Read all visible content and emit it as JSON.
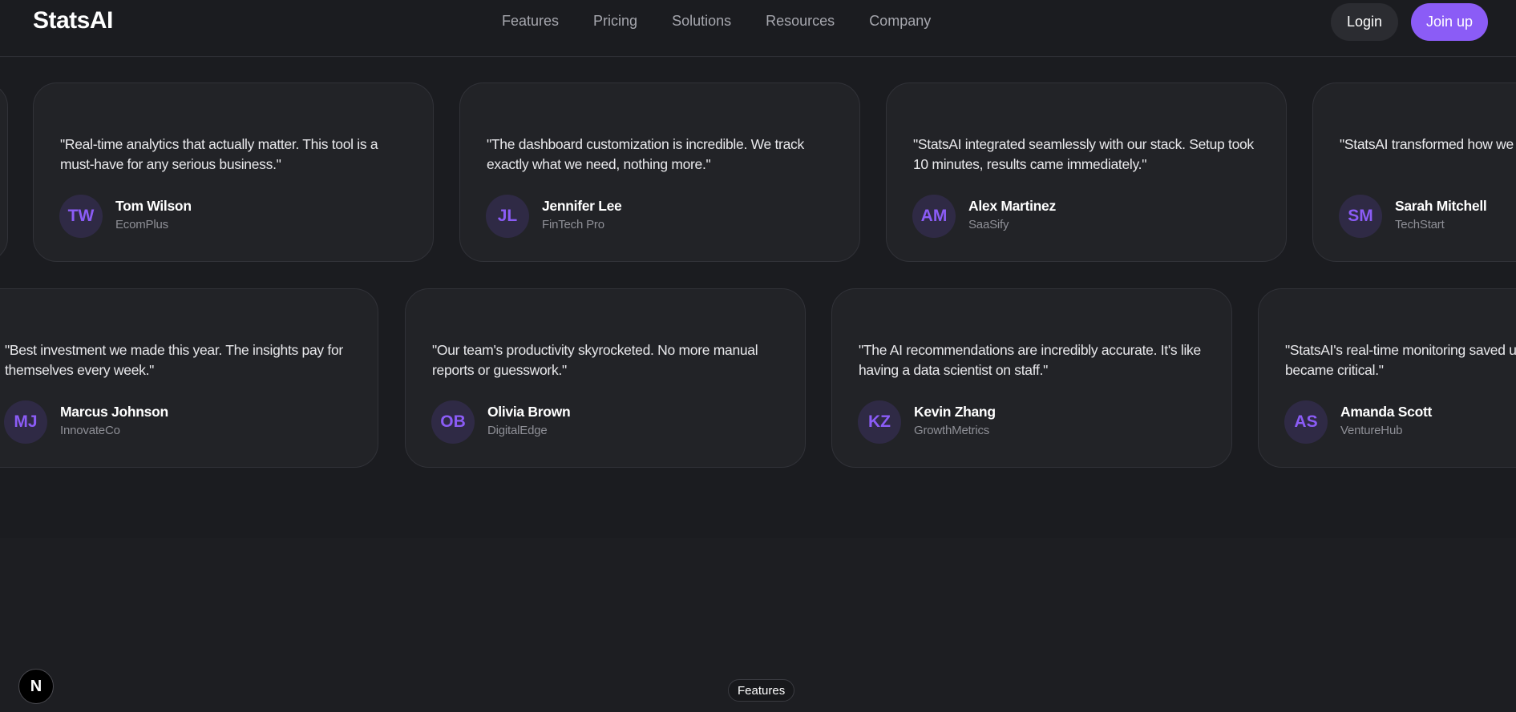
{
  "header": {
    "brand": "StatsAI",
    "nav": [
      "Features",
      "Pricing",
      "Solutions",
      "Resources",
      "Company"
    ],
    "login_label": "Login",
    "join_label": "Join up"
  },
  "testimonials": {
    "row1": [
      {
        "quote": "\"Real-time analytics that actually matter. This tool is a must-have for any serious business.\"",
        "initials": "TW",
        "name": "Tom Wilson",
        "company": "EcomPlus"
      },
      {
        "quote": "\"The dashboard customization is incredible. We track exactly what we need, nothing more.\"",
        "initials": "JL",
        "name": "Jennifer Lee",
        "company": "FinTech Pro"
      },
      {
        "quote": "\"StatsAI integrated seamlessly with our stack. Setup took 10 minutes, results came immediately.\"",
        "initials": "AM",
        "name": "Alex Martinez",
        "company": "SaaSify"
      },
      {
        "quote": "\"StatsAI transformed how we u... The predictive analytics saved...",
        "initials": "SM",
        "name": "Sarah Mitchell",
        "company": "TechStart"
      }
    ],
    "row2": [
      {
        "quote": "\"Best investment we made this year. The insights pay for themselves every week.\"",
        "initials": "MJ",
        "name": "Marcus Johnson",
        "company": "InnovateCo"
      },
      {
        "quote": "\"Our team's productivity skyrocketed. No more manual reports or guesswork.\"",
        "initials": "OB",
        "name": "Olivia Brown",
        "company": "DigitalEdge"
      },
      {
        "quote": "\"The AI recommendations are incredibly accurate. It's like having a data scientist on staff.\"",
        "initials": "KZ",
        "name": "Kevin Zhang",
        "company": "GrowthMetrics"
      },
      {
        "quote": "\"StatsAI's real-time monitoring saved us... before it became critical.\"",
        "initials": "AS",
        "name": "Amanda Scott",
        "company": "VentureHub"
      }
    ]
  },
  "footer": {
    "n_badge": "N",
    "features_pill": "Features"
  },
  "colors": {
    "accent": "#8b5cf6",
    "background": "#1d1e22",
    "card": "#222327"
  }
}
